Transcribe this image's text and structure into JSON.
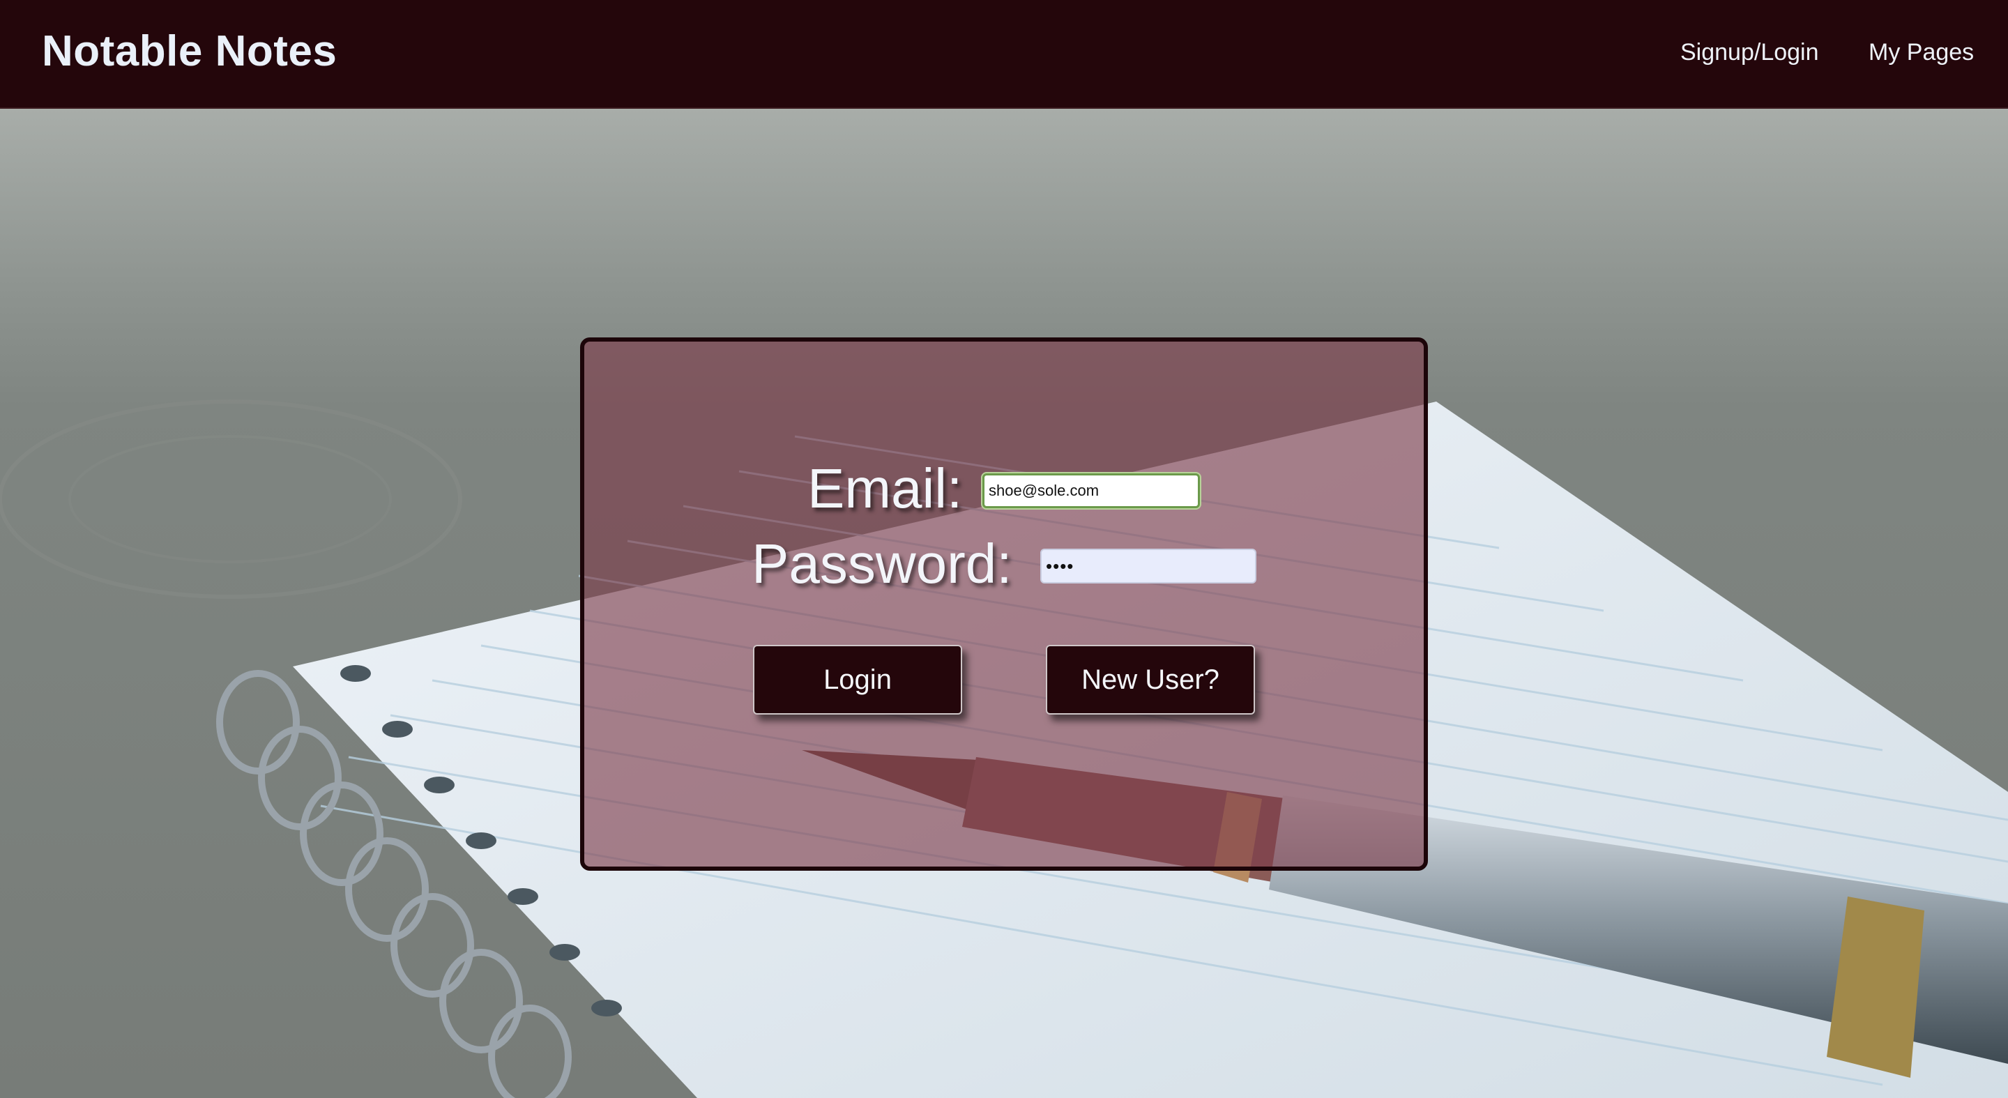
{
  "header": {
    "brand": "Notable Notes",
    "nav": {
      "signup_login": "Signup/Login",
      "my_pages": "My Pages"
    }
  },
  "login_form": {
    "email_label": "Email:",
    "email_value": "shoe@sole.com",
    "password_label": "Password:",
    "password_value": "••••",
    "login_button": "Login",
    "new_user_button": "New User?"
  },
  "colors": {
    "header_bg": "#24060b",
    "panel_bg": "#7c3a48",
    "button_bg": "#24060b",
    "text_light": "#eaf0f9"
  },
  "background_image": "notebook-and-fountain-pen-on-desk"
}
